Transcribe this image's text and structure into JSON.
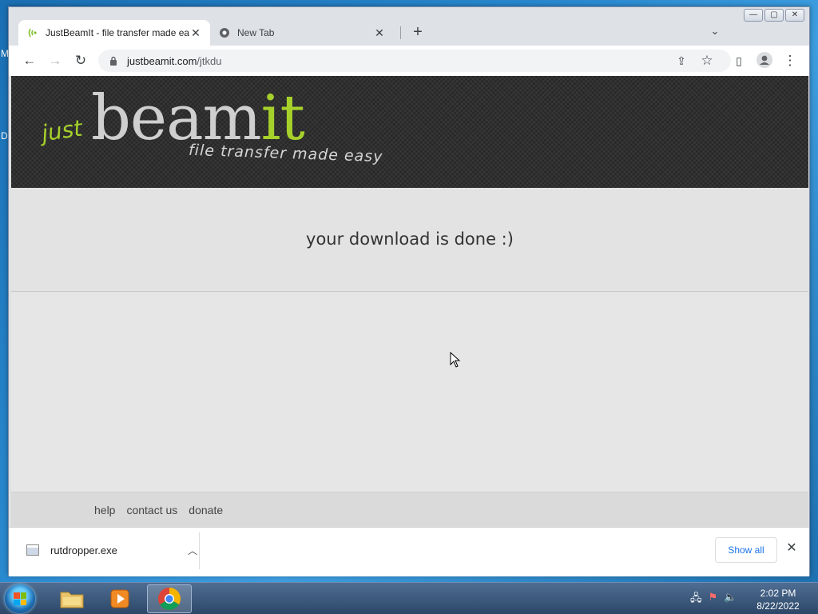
{
  "desktop": {
    "letters": [
      "M",
      "D"
    ]
  },
  "tabs": [
    {
      "title": "JustBeamIt - file transfer made easy",
      "active": true,
      "favicon": "beam-favicon"
    },
    {
      "title": "New Tab",
      "active": false,
      "favicon": "chrome-favicon"
    }
  ],
  "window_controls": {
    "minimize": "—",
    "maximize": "▢",
    "close": "✕"
  },
  "toolbar": {
    "url_host": "justbeamit.com",
    "url_path": "/jtkdu"
  },
  "page": {
    "logo_just": "just",
    "logo_beam": "beam",
    "logo_it": "it",
    "tagline": "file transfer made easy",
    "message": "your download is done :)",
    "footer_links": [
      "help",
      "contact us",
      "donate"
    ]
  },
  "download_bar": {
    "filename": "rutdropper.exe",
    "show_all": "Show all"
  },
  "taskbar": {
    "time": "2:02 PM",
    "date": "8/22/2022"
  },
  "colors": {
    "accent_green": "#a6d12b",
    "link_blue": "#1a73e8"
  }
}
